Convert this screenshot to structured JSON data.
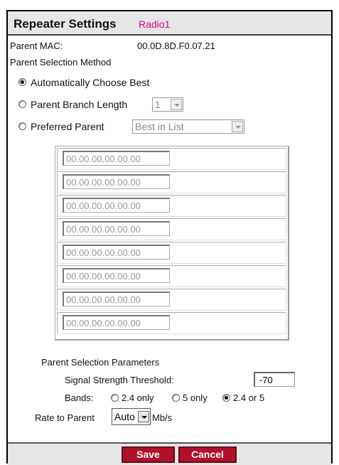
{
  "header": {
    "title": "Repeater Settings",
    "subtitle": "Radio1"
  },
  "parent_mac": {
    "label": "Parent MAC:",
    "value": "00.0D.8D.F0.07.21"
  },
  "method": {
    "heading": "Parent Selection Method",
    "options": [
      {
        "label": "Automatically Choose Best",
        "selected": true
      },
      {
        "label": "Parent Branch Length",
        "selected": false
      },
      {
        "label": "Preferred Parent",
        "selected": false
      }
    ],
    "branch_length_value": "1",
    "preferred_value": "Best in List",
    "mac_list": [
      "00.00.00.00.00.00",
      "00.00.00.00.00.00",
      "00.00.00.00.00.00",
      "00.00.00.00.00.00",
      "00.00.00.00.00.00",
      "00.00.00.00.00.00",
      "00.00.00.00.00.00",
      "00.00.00.00.00.00"
    ]
  },
  "params": {
    "heading": "Parent Selection Parameters",
    "signal_label": "Signal Strength Threshold:",
    "signal_value": "-70",
    "bands_label": "Bands:",
    "bands": [
      {
        "label": "2.4 only",
        "selected": false
      },
      {
        "label": "5 only",
        "selected": false
      },
      {
        "label": "2.4 or 5",
        "selected": true
      }
    ],
    "rate_label": "Rate to Parent",
    "rate_value": "Auto",
    "rate_unit": "Mb/s"
  },
  "actions": {
    "save": "Save",
    "cancel": "Cancel"
  },
  "colors": {
    "subtitle": "#e0008c",
    "button": "#b0102a",
    "header_bg": "#e6e6e6"
  }
}
